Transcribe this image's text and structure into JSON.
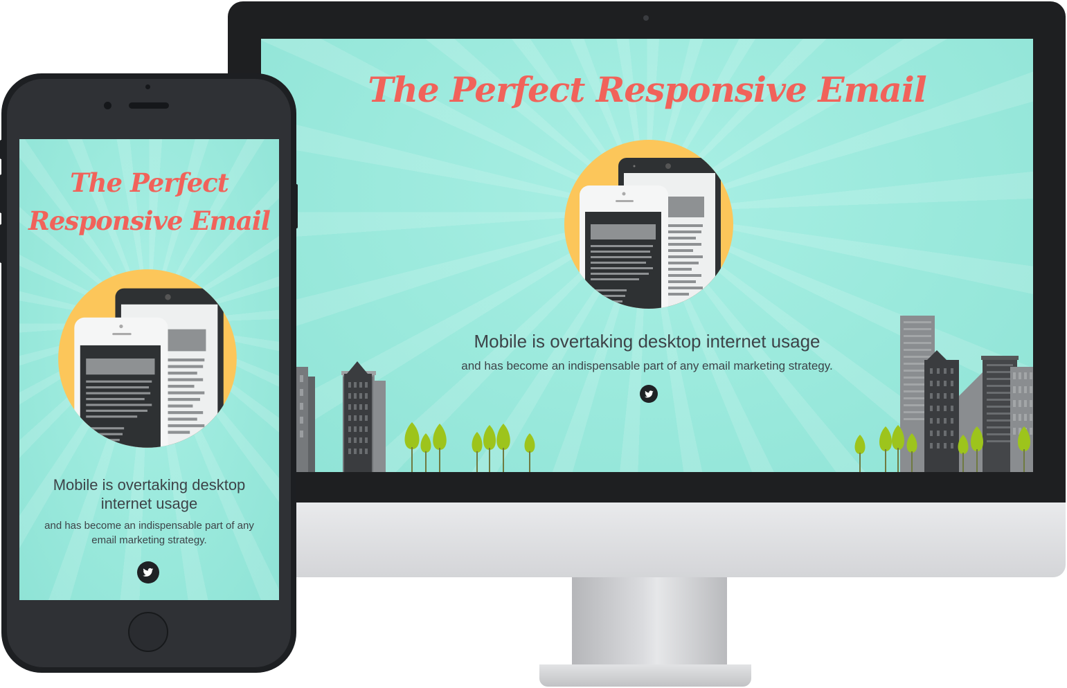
{
  "desktop": {
    "title": "The Perfect Responsive Email",
    "headline": "Mobile is overtaking desktop internet usage",
    "subtext": "and has become an indispensable part of any email marketing strategy.",
    "social_icon": "twitter-icon"
  },
  "mobile": {
    "title_line1": "The Perfect",
    "title_line2": "Responsive Email",
    "headline": "Mobile is overtaking desktop internet usage",
    "subtext": "and has become an indispensable part of any email marketing strategy.",
    "social_icon": "twitter-icon"
  },
  "colors": {
    "background": "#9ae9dc",
    "title": "#f1625a",
    "text": "#3d4348",
    "sun": "#fcc65a",
    "device_dark": "#2e3133",
    "tree": "#9dc41c"
  }
}
